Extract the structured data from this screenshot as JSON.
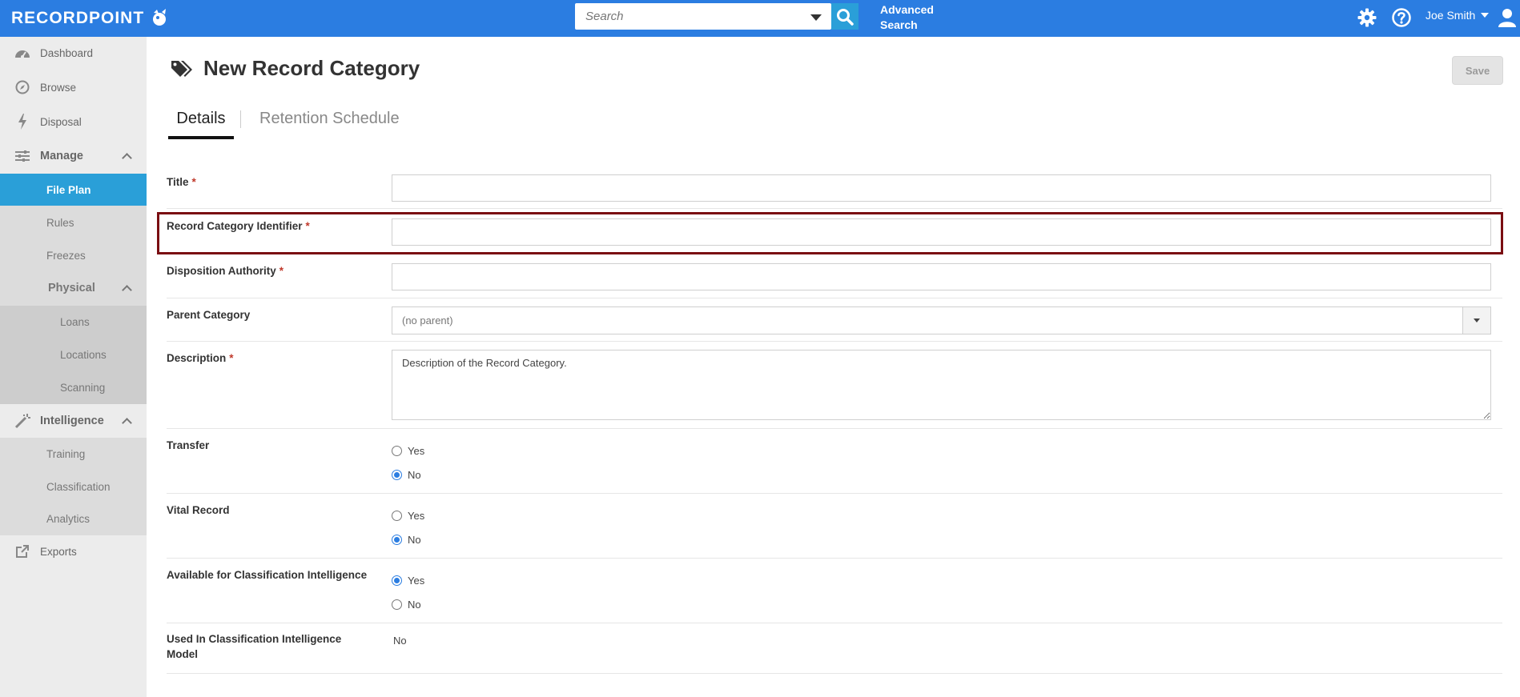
{
  "app": {
    "logo_text": "RECORDPOINT",
    "search_placeholder": "Search",
    "advanced_search_line1": "Advanced",
    "advanced_search_line2": "Search",
    "user_name": "Joe Smith",
    "accent_color": "#2b7de1"
  },
  "sidebar": {
    "dashboard": "Dashboard",
    "browse": "Browse",
    "disposal": "Disposal",
    "manage": "Manage",
    "file_plan": "File Plan",
    "rules": "Rules",
    "freezes": "Freezes",
    "physical": "Physical",
    "loans": "Loans",
    "locations": "Locations",
    "scanning": "Scanning",
    "intelligence": "Intelligence",
    "training": "Training",
    "classification": "Classification",
    "analytics": "Analytics",
    "exports": "Exports"
  },
  "page": {
    "title": "New Record Category",
    "save_label": "Save",
    "tabs": [
      "Details",
      "Retention Schedule"
    ]
  },
  "form": {
    "title_label": "Title",
    "identifier_label": "Record Category Identifier",
    "disposition_label": "Disposition Authority",
    "parent_label": "Parent Category",
    "parent_value": "(no parent)",
    "description_label": "Description",
    "description_value": "Description of the Record Category.",
    "transfer_label": "Transfer",
    "vital_label": "Vital Record",
    "available_label": "Available for Classification Intelligence",
    "used_label_line1": "Used In Classification Intelligence",
    "used_label_line2": "Model",
    "used_value": "No",
    "yes": "Yes",
    "no": "No",
    "required_mark": "*"
  }
}
